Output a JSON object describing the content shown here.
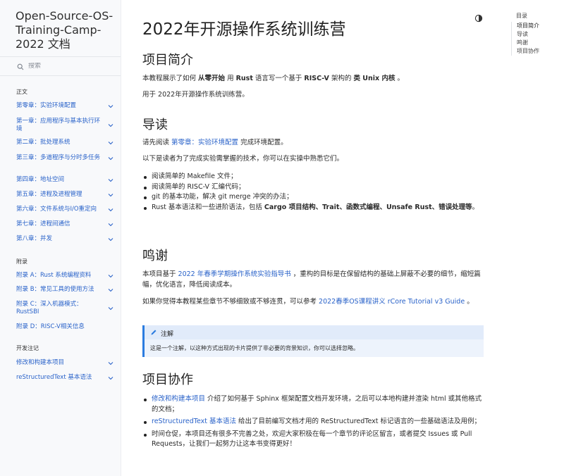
{
  "brand": {
    "title": "Open-Source-OS-Training-Camp-2022 文档"
  },
  "search": {
    "placeholder": "搜索"
  },
  "sidebar": {
    "caption_main": "正文",
    "main_items": [
      {
        "label": "第零章：实验环境配置"
      },
      {
        "label": "第一章：应用程序与基本执行环境"
      },
      {
        "label": "第二章：批处理系统"
      },
      {
        "label": "第三章：多道程序与分时多任务"
      },
      {
        "label": "第四章：地址空间"
      },
      {
        "label": "第五章：进程及进程管理"
      },
      {
        "label": "第六章：文件系统与I/O重定向"
      },
      {
        "label": "第七章：进程间通信"
      },
      {
        "label": "第八章：并发"
      }
    ],
    "caption_appendix": "附录",
    "appendix_items": [
      {
        "label": "附录 A：Rust 系统编程资料"
      },
      {
        "label": "附录 B：常见工具的使用方法"
      },
      {
        "label": "附录 C：深入机器模式：RustSBI"
      },
      {
        "label": "附录 D：RISC-V相关信息"
      }
    ],
    "caption_dev": "开发注记",
    "dev_items": [
      {
        "label": "修改和构建本项目"
      },
      {
        "label": "reStructuredText 基本语法"
      }
    ]
  },
  "page": {
    "title": "2022年开源操作系统训练营",
    "intro": {
      "heading": "项目简介",
      "p1": {
        "t1": "本教程展示了如何 ",
        "b1": "从零开始",
        "t2": " 用 ",
        "b2": "Rust",
        "t3": " 语言写一个基于 ",
        "b3": "RISC-V",
        "t4": " 架构的 ",
        "b4": "类 Unix 内核",
        "t5": " 。"
      },
      "p2": "用于 2022年开源操作系统训练营。"
    },
    "guide": {
      "heading": "导读",
      "p1": {
        "t1": "请先阅读 ",
        "link": "第零章：实验环境配置",
        "t2": " 完成环境配置。"
      },
      "p2": "以下是读者为了完成实验需掌握的技术，你可以在实操中熟悉它们。",
      "items": [
        {
          "text": "阅读简单的 Makefile 文件；"
        },
        {
          "text": "阅读简单的 RISC-V 汇编代码；"
        },
        {
          "text": "git 的基本功能，解决 git merge 冲突的办法；"
        }
      ],
      "last_item": {
        "t1": "Rust 基本语法和一些进阶语法，包括 ",
        "b1": "Cargo 项目结构、Trait、函数式编程、Unsafe Rust、错误处理等",
        "t2": "。"
      }
    },
    "thanks": {
      "heading": "鸣谢",
      "p1": {
        "t1": "本项目基于 ",
        "link": "2022 年春季学期操作系统实验指导书",
        "t2": " ，重构的目标是在保留结构的基础上屏蔽不必要的细节，缩短篇幅，优化语言，降低阅读成本。"
      },
      "p2": {
        "t1": "如果你觉得本教程某些章节不够细致或不够连贯，可以参考 ",
        "link": "2022春季OS课程讲义 rCore Tutorial v3 Guide",
        "t2": " 。"
      }
    },
    "note": {
      "title": "注解",
      "body": "这是一个注解，以这种方式出现的卡片提供了非必要的背景知识，你可以选择忽略。"
    },
    "collab": {
      "heading": "项目协作",
      "items": [
        {
          "link": "修改和构建本项目",
          "text": " 介绍了如何基于 Sphinx 框架配置文档开发环境，之后可以本地构建并渲染 html 或其他格式的文档；"
        },
        {
          "link": "reStructuredText 基本语法",
          "text": " 给出了目前编写文档才用的 ReStructuredText 标记语言的一些基础语法及用例；"
        },
        {
          "link": "",
          "text": "时间仓促，本项目还有很多不完善之处，欢迎大家积极在每一个章节的评论区留言，或者提交 Issues 或 Pull Requests，让我们一起努力让这本书变得更好！"
        }
      ]
    }
  },
  "toc": {
    "title": "目录",
    "items": [
      {
        "label": "项目简介"
      },
      {
        "label": "导读"
      },
      {
        "label": "鸣谢"
      },
      {
        "label": "项目协作"
      }
    ]
  },
  "colors": {
    "link": "#2962c9",
    "note_accent": "#2b7ce0",
    "sidebar_bg": "#f8f9fb"
  },
  "icons": [
    "search-icon",
    "chevron-down-icon",
    "theme-toggle-icon",
    "pencil-icon"
  ]
}
